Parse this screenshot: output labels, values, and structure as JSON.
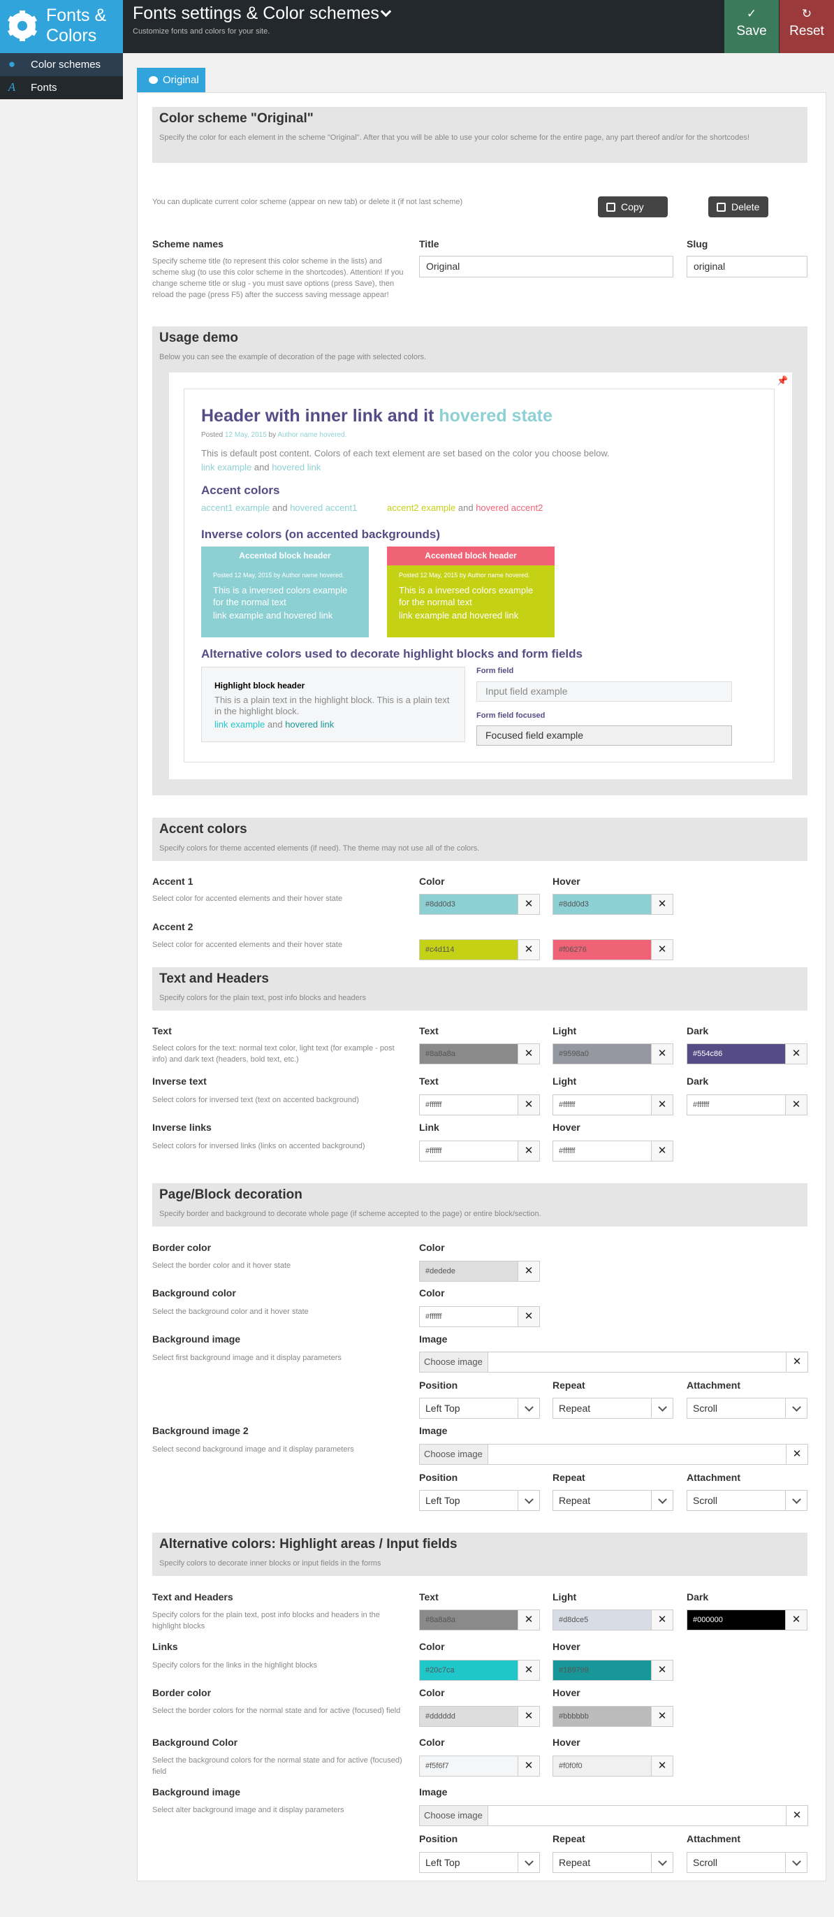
{
  "logo": {
    "title": "Fonts & Colors",
    "icon": "gear-icon"
  },
  "header": {
    "title": "Fonts settings & Color schemes",
    "subtitle": "Customize fonts and colors for your site.",
    "save": "Save",
    "reset": "Reset"
  },
  "sidebar": {
    "items": [
      {
        "label": "Color schemes",
        "icon": "palette-icon"
      },
      {
        "label": "Fonts",
        "icon": "font-icon"
      }
    ]
  },
  "tab": {
    "label": "Original"
  },
  "scheme": {
    "title": "Color scheme \"Original\"",
    "desc": "Specify the color for each element in the scheme \"Original\". After that you will be able to use your color scheme for the entire page, any part thereof and/or for the shortcodes!",
    "dup_text": "You can duplicate current color scheme (appear on new tab) or delete it (if not last scheme)",
    "copy": "Copy",
    "delete": "Delete",
    "names_label": "Scheme names",
    "names_desc": "Specify scheme title (to represent this color scheme in the lists) and scheme slug (to use this color scheme in the shortcodes). Attention! If you change scheme title or slug - you must save options (press Save), then reload the page (press F5) after the success saving message appear!",
    "title_label": "Title",
    "title_value": "Original",
    "slug_label": "Slug",
    "slug_value": "original"
  },
  "usage": {
    "title": "Usage demo",
    "desc": "Below you can see the example of decoration of the page with selected colors.",
    "h1": "Header with inner link and it ",
    "h1_hover": "hovered state",
    "posted": "Posted ",
    "date": "12 May, 2015",
    "by": " by ",
    "author": "Author name hovered.",
    "body": "This is default post content. Colors of each text element are set based on the color you choose below.",
    "link": "link example",
    "and": " and ",
    "hlink": "hovered link",
    "accent_h": "Accent colors",
    "a1": "accent1 example",
    "ha1": "hovered accent1",
    "a2": "accent2 example",
    "ha2": "hovered accent2",
    "inverse_h": "Inverse colors (on accented backgrounds)",
    "block_hdr": "Accented block header",
    "block_meta": "Posted 12 May, 2015 by Author name hovered.",
    "block_text": "This is a inversed colors example for the normal text",
    "block_link": "link example and hovered link",
    "alt_h": "Alternative colors used to decorate highlight blocks and form fields",
    "hl_hdr": "Highlight block header",
    "hl_text": "This is a plain text in the highlight block. This is a plain text in the highlight block.",
    "form_field": "Form field",
    "input_ph": "Input field example",
    "form_focused": "Form field focused",
    "focused_val": "Focused field example"
  },
  "accent": {
    "title": "Accent colors",
    "desc": "Specify colors for theme accented elements (if need). The theme may not use all of the colors.",
    "rows": [
      {
        "label": "Accent 1",
        "desc": "Select color for accented elements and their hover state",
        "c1": "#8dd0d3",
        "c2": "#8dd0d3"
      },
      {
        "label": "Accent 2",
        "desc": "Select color for accented elements and their hover state",
        "c1": "#c4d114",
        "c2": "#f06276"
      }
    ],
    "color": "Color",
    "hover": "Hover"
  },
  "text": {
    "title": "Text and Headers",
    "desc": "Specify colors for the plain text, post info blocks and headers",
    "r1": {
      "label": "Text",
      "desc": "Select colors for the text: normal text color, light text (for example - post info) and dark text (headers, bold text, etc.)",
      "c1": "#8a8a8a",
      "c2": "#9598a0",
      "c3": "#554c86"
    },
    "r2": {
      "label": "Inverse text",
      "desc": "Select colors for inversed text (text on accented background)",
      "c1": "#ffffff",
      "c2": "#ffffff",
      "c3": "#ffffff"
    },
    "r3": {
      "label": "Inverse links",
      "desc": "Select colors for inversed links (links on accented background)",
      "c1": "#ffffff",
      "c2": "#ffffff"
    },
    "text": "Text",
    "light": "Light",
    "dark": "Dark",
    "link": "Link",
    "hover": "Hover"
  },
  "deco": {
    "title": "Page/Block decoration",
    "desc": "Specify border and background to decorate whole page (if scheme accepted to the page) or entire block/section.",
    "border": {
      "label": "Border color",
      "desc": "Select the border color and it hover state",
      "c": "#dedede"
    },
    "bg": {
      "label": "Background color",
      "desc": "Select the background color and it hover state",
      "c": "#ffffff"
    },
    "img1": {
      "label": "Background image",
      "desc": "Select first background image and it display parameters"
    },
    "img2": {
      "label": "Background image 2",
      "desc": "Select second background image and it display parameters"
    },
    "color": "Color",
    "image": "Image",
    "choose": "Choose image",
    "position": "Position",
    "repeat": "Repeat",
    "attachment": "Attachment",
    "pos_val": "Left Top",
    "rep_val": "Repeat",
    "att_val": "Scroll"
  },
  "alt": {
    "title": "Alternative colors: Highlight areas / Input fields",
    "desc": "Specify colors to decorate inner blocks or input fields in the forms",
    "r1": {
      "label": "Text and Headers",
      "desc": "Specify colors for the plain text, post info blocks and headers in the highlight blocks",
      "c1": "#8a8a8a",
      "c2": "#d8dce5",
      "c3": "#000000"
    },
    "r2": {
      "label": "Links",
      "desc": "Specify colors for the links in the highlight blocks",
      "c1": "#20c7ca",
      "c2": "#189799"
    },
    "r3": {
      "label": "Border color",
      "desc": "Select the border colors for the normal state and for active (focused) field",
      "c1": "#dddddd",
      "c2": "#bbbbbb"
    },
    "r4": {
      "label": "Background Color",
      "desc": "Select the background colors for the normal state and for active (focused) field",
      "c1": "#f5f6f7",
      "c2": "#f0f0f0"
    },
    "r5": {
      "label": "Background image",
      "desc": "Select alter background image and it display parameters"
    },
    "text": "Text",
    "light": "Light",
    "dark": "Dark",
    "color": "Color",
    "hover": "Hover",
    "image": "Image"
  },
  "colors": {
    "accent1": "#8dd0d3",
    "accent2": "#c4d114",
    "hover2": "#f06276",
    "dark": "#554c86",
    "brand": "#31a4db"
  }
}
